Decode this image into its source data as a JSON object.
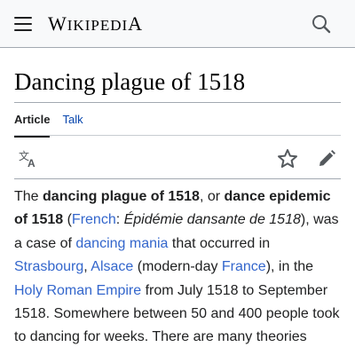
{
  "header": {
    "logo": {
      "first": "W",
      "rest": "IKIPEDI",
      "last": "A"
    },
    "menu_icon": "menu-icon",
    "search_icon": "search-icon"
  },
  "page": {
    "title": "Dancing plague of 1518"
  },
  "tabs": [
    {
      "label": "Article",
      "active": true
    },
    {
      "label": "Talk",
      "active": false
    }
  ],
  "toolbar": {
    "language_icon": "language-icon",
    "watch_icon": "star-icon",
    "edit_icon": "pencil-icon"
  },
  "article": {
    "t1": "The ",
    "b1": "dancing plague of 1518",
    "t2": ", or ",
    "b2": "dance epidemic of 1518",
    "t3": " (",
    "l_french": "French",
    "t4": ": ",
    "i1": "Épidémie dansante de 1518",
    "t5": "), was a case of ",
    "l_mania": "dancing mania",
    "t6": " that occurred in ",
    "l_strasbourg": "Strasbourg",
    "t7": ", ",
    "l_alsace": "Alsace",
    "t8": " (modern-day ",
    "l_france": "France",
    "t9": "), in the ",
    "l_hre": "Holy Roman Empire",
    "t10": " from July 1518 to September 1518. Somewhere between 50 and 400 people took to dancing for weeks. There are many theories"
  },
  "colors": {
    "link": "#3366cc",
    "header_bg": "#f8f9fa",
    "text": "#202122"
  }
}
